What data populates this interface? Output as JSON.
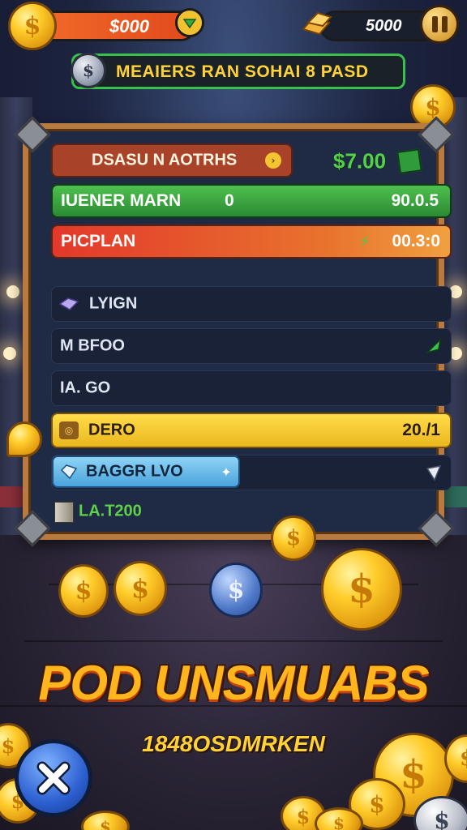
{
  "hud": {
    "coins_value": "$000",
    "gems_value": "5000",
    "pause_icon": "pause-icon"
  },
  "banner": {
    "text": "MEAIERS RAN SOHAI 8 PASD"
  },
  "panel": {
    "row1": {
      "label": "DSASU N AOTRHS",
      "price": "$7.00"
    },
    "row2": {
      "label": "IUENER MARN",
      "mid": "0",
      "value": "90.0.5"
    },
    "row3": {
      "label": "PICPLAN",
      "value": "00.3:0"
    },
    "row4": {
      "label": "LYIGN"
    },
    "row5": {
      "label": "M  BFOO"
    },
    "row6": {
      "label": "IA.  GO"
    },
    "row7": {
      "label": "DERO",
      "value": "20./1"
    },
    "row8": {
      "label": "BAGGR LVO"
    },
    "row9": {
      "label": "LA.T200"
    }
  },
  "title": "POD UNSMUABS",
  "subtitle": "1848OSDMRKEN",
  "colors": {
    "gold": "#ffcc2a",
    "panel_frame": "#b97a40",
    "green_bar": "#3aa33f",
    "orange_bar": "#e2622a",
    "yellow_bar": "#f2c531",
    "blue_bar": "#5fb6e6"
  }
}
